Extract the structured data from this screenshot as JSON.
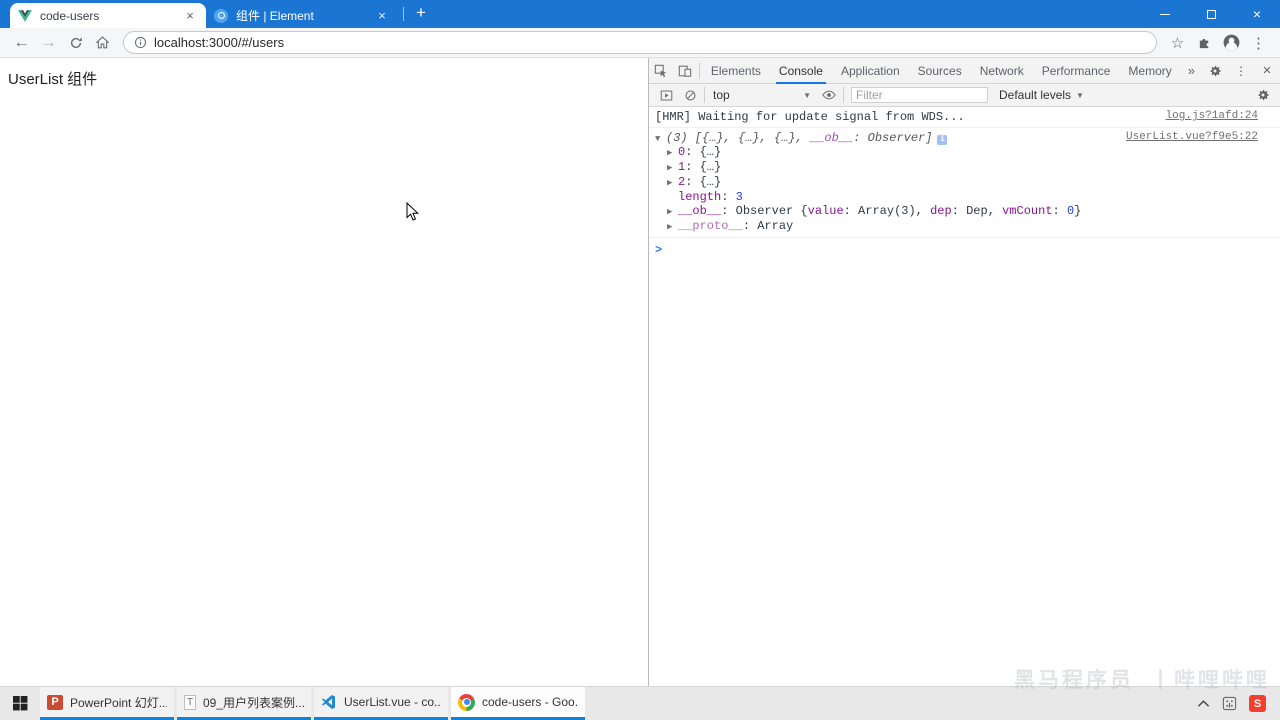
{
  "icons": {
    "back": "←",
    "forward": "→",
    "star": "☆",
    "menu_dots": "⋮",
    "window_close": "×",
    "tab_close": "×",
    "new_tab": "+",
    "dropdown_arrow": "▼",
    "expand_open": "▼",
    "expand_closed": "▶",
    "prompt": ">",
    "more_tools": "»",
    "info_badge": "i",
    "sogou": "S",
    "powerpoint_letter": "P",
    "textfile_letter": "T"
  },
  "browser": {
    "tabs": [
      {
        "title": "code-users",
        "icon": "vue-logo",
        "active": true
      },
      {
        "title": "组件 | Element",
        "icon": "element-logo",
        "active": false
      }
    ],
    "url": "localhost:3000/#/users"
  },
  "page": {
    "heading": "UserList 组件"
  },
  "devtools": {
    "tabs": [
      "Elements",
      "Console",
      "Application",
      "Sources",
      "Network",
      "Performance",
      "Memory"
    ],
    "active_tab": "Console",
    "more_label": "»",
    "toolbar": {
      "context": "top",
      "filter_placeholder": "Filter",
      "levels_label": "Default levels"
    },
    "console": {
      "message1": {
        "text": "[HMR] Waiting for update signal from WDS...",
        "source": "log.js?1afd:24"
      },
      "group": {
        "header_tokens": [
          {
            "t": "(3) [{…}, {…}, {…}, ",
            "s": "pv"
          },
          {
            "t": "__ob__",
            "s": "pvkey"
          },
          {
            "t": ": Observer]",
            "s": "pv"
          }
        ],
        "source": "UserList.vue?f9e5:22",
        "children": [
          {
            "expand": true,
            "tokens": [
              {
                "t": "0",
                "s": "key"
              },
              {
                "t": ": ",
                "s": "pl"
              },
              {
                "t": "{…}",
                "s": "pl"
              }
            ]
          },
          {
            "expand": true,
            "tokens": [
              {
                "t": "1",
                "s": "key"
              },
              {
                "t": ": ",
                "s": "pl"
              },
              {
                "t": "{…}",
                "s": "pl"
              }
            ]
          },
          {
            "expand": true,
            "tokens": [
              {
                "t": "2",
                "s": "key"
              },
              {
                "t": ": ",
                "s": "pl"
              },
              {
                "t": "{…}",
                "s": "pl"
              }
            ]
          },
          {
            "expand": false,
            "tokens": [
              {
                "t": "length",
                "s": "key"
              },
              {
                "t": ": ",
                "s": "pl"
              },
              {
                "t": "3",
                "s": "num"
              }
            ]
          },
          {
            "expand": true,
            "tokens": [
              {
                "t": "__ob__",
                "s": "key"
              },
              {
                "t": ": ",
                "s": "pl"
              },
              {
                "t": "Observer {",
                "s": "pl"
              },
              {
                "t": "value",
                "s": "key"
              },
              {
                "t": ": Array(3), ",
                "s": "pl"
              },
              {
                "t": "dep",
                "s": "key"
              },
              {
                "t": ": Dep, ",
                "s": "pl"
              },
              {
                "t": "vmCount",
                "s": "key"
              },
              {
                "t": ": ",
                "s": "pl"
              },
              {
                "t": "0",
                "s": "num"
              },
              {
                "t": "}",
                "s": "pl"
              }
            ]
          },
          {
            "expand": true,
            "tokens": [
              {
                "t": "__proto__",
                "s": "keydim"
              },
              {
                "t": ": ",
                "s": "pl"
              },
              {
                "t": "Array",
                "s": "pl"
              }
            ]
          }
        ]
      }
    }
  },
  "taskbar": {
    "items": [
      {
        "label": "PowerPoint 幻灯...",
        "icon": "powerpoint",
        "active": false
      },
      {
        "label": "09_用户列表案例....",
        "icon": "textfile",
        "active": false
      },
      {
        "label": "UserList.vue - co...",
        "icon": "vscode",
        "active": false
      },
      {
        "label": "code-users - Goo...",
        "icon": "chrome",
        "active": true
      }
    ]
  },
  "watermark": {
    "text": "黑马程序员",
    "brand": "丨哔哩哔哩"
  },
  "colors": {
    "titlebar_blue": "#1a76d2",
    "devtools_accent": "#1a73e8",
    "taskbar_underline": "#1283d8",
    "console_key_purple": "#881391",
    "console_number_blue": "#1f3ecf"
  }
}
